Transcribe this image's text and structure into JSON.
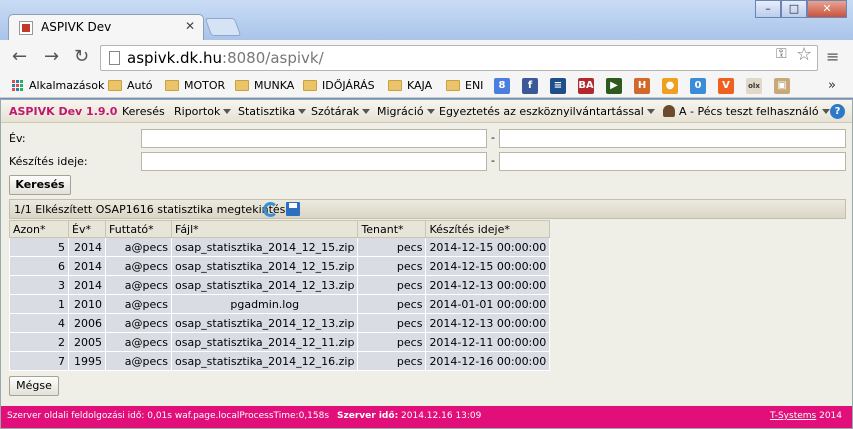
{
  "browser": {
    "tab_title": "ASPIVK Dev",
    "url_host": "aspivk.dk.hu",
    "url_rest": ":8080/aspivk/",
    "window_buttons": [
      "–",
      "□",
      "✕"
    ]
  },
  "bookmarks": {
    "apps_label": "Alkalmazások",
    "folders": [
      "Autó",
      "MOTOR",
      "MUNKA",
      "IDŐJÁRÁS",
      "KAJA",
      "ENI"
    ],
    "icons": [
      {
        "name": "google-icon",
        "text": "8",
        "color": "#4a7fe0"
      },
      {
        "name": "facebook-icon",
        "text": "f",
        "color": "#3b5998"
      },
      {
        "name": "bookmark-icon-blue",
        "text": "≡",
        "color": "#1f4f8a"
      },
      {
        "name": "ba-icon",
        "text": "BA",
        "color": "#b3282d"
      },
      {
        "name": "play-icon",
        "text": "▶",
        "color": "#2f5a1e"
      },
      {
        "name": "h-icon",
        "text": "H",
        "color": "#d2692a"
      },
      {
        "name": "circle-icon",
        "text": "●",
        "color": "#f0a020"
      },
      {
        "name": "zero-icon",
        "text": "0",
        "color": "#3a8ed8"
      },
      {
        "name": "v-icon",
        "text": "V",
        "color": "#f06020"
      },
      {
        "name": "olx-icon",
        "text": "olx",
        "color": "#e0d8c8"
      },
      {
        "name": "box-icon",
        "text": "▣",
        "color": "#c8a878"
      }
    ]
  },
  "app": {
    "brand": "ASPIVK Dev 1.9.0",
    "menu": [
      {
        "label": "Keresés",
        "dropdown": false
      },
      {
        "label": "Riportok",
        "dropdown": true
      },
      {
        "label": "Statisztika",
        "dropdown": true
      },
      {
        "label": "Szótárak",
        "dropdown": true
      },
      {
        "label": "Migráció",
        "dropdown": true
      },
      {
        "label": "Egyeztetés az eszköznyilvántartással",
        "dropdown": true
      }
    ],
    "user": "A - Pécs teszt felhasználó",
    "help": "?"
  },
  "filters": {
    "year_label": "Év:",
    "created_label": "Készítés ideje:",
    "range_sep": "-",
    "search_button": "Keresés"
  },
  "panel": {
    "title": "1/1  Elkészített OSAP1616 statisztika megtekintése"
  },
  "table": {
    "headers": [
      "Azon*",
      "Év*",
      "Futtató*",
      "Fájl*",
      "Tenant*",
      "Készítés ideje*"
    ],
    "rows": [
      [
        "5",
        "2014",
        "a@pecs",
        "osap_statisztika_2014_12_15.zip",
        "pecs",
        "2014-12-15 00:00:00"
      ],
      [
        "6",
        "2014",
        "a@pecs",
        "osap_statisztika_2014_12_15.zip",
        "pecs",
        "2014-12-15 00:00:00"
      ],
      [
        "3",
        "2014",
        "a@pecs",
        "osap_statisztika_2014_12_13.zip",
        "pecs",
        "2014-12-13 00:00:00"
      ],
      [
        "1",
        "2010",
        "a@pecs",
        "pgadmin.log",
        "pecs",
        "2014-01-01 00:00:00"
      ],
      [
        "4",
        "2006",
        "a@pecs",
        "osap_statisztika_2014_12_13.zip",
        "pecs",
        "2014-12-13 00:00:00"
      ],
      [
        "2",
        "2005",
        "a@pecs",
        "osap_statisztika_2014_12_11.zip",
        "pecs",
        "2014-12-11 00:00:00"
      ],
      [
        "7",
        "1995",
        "a@pecs",
        "osap_statisztika_2014_12_16.zip",
        "pecs",
        "2014-12-16 00:00:00"
      ]
    ]
  },
  "cancel_button": "Mégse",
  "footer": {
    "processing": "Szerver oldali feldolgozási idő: 0,01s waf.page.localProcessTime:0,158s",
    "server_time_label": "Szerver idő:",
    "server_time": "2014.12.16 13:09",
    "company": "T-Systems",
    "year": "2014"
  },
  "colors": {
    "brand": "#c0186e",
    "footer": "#e20f7a"
  }
}
